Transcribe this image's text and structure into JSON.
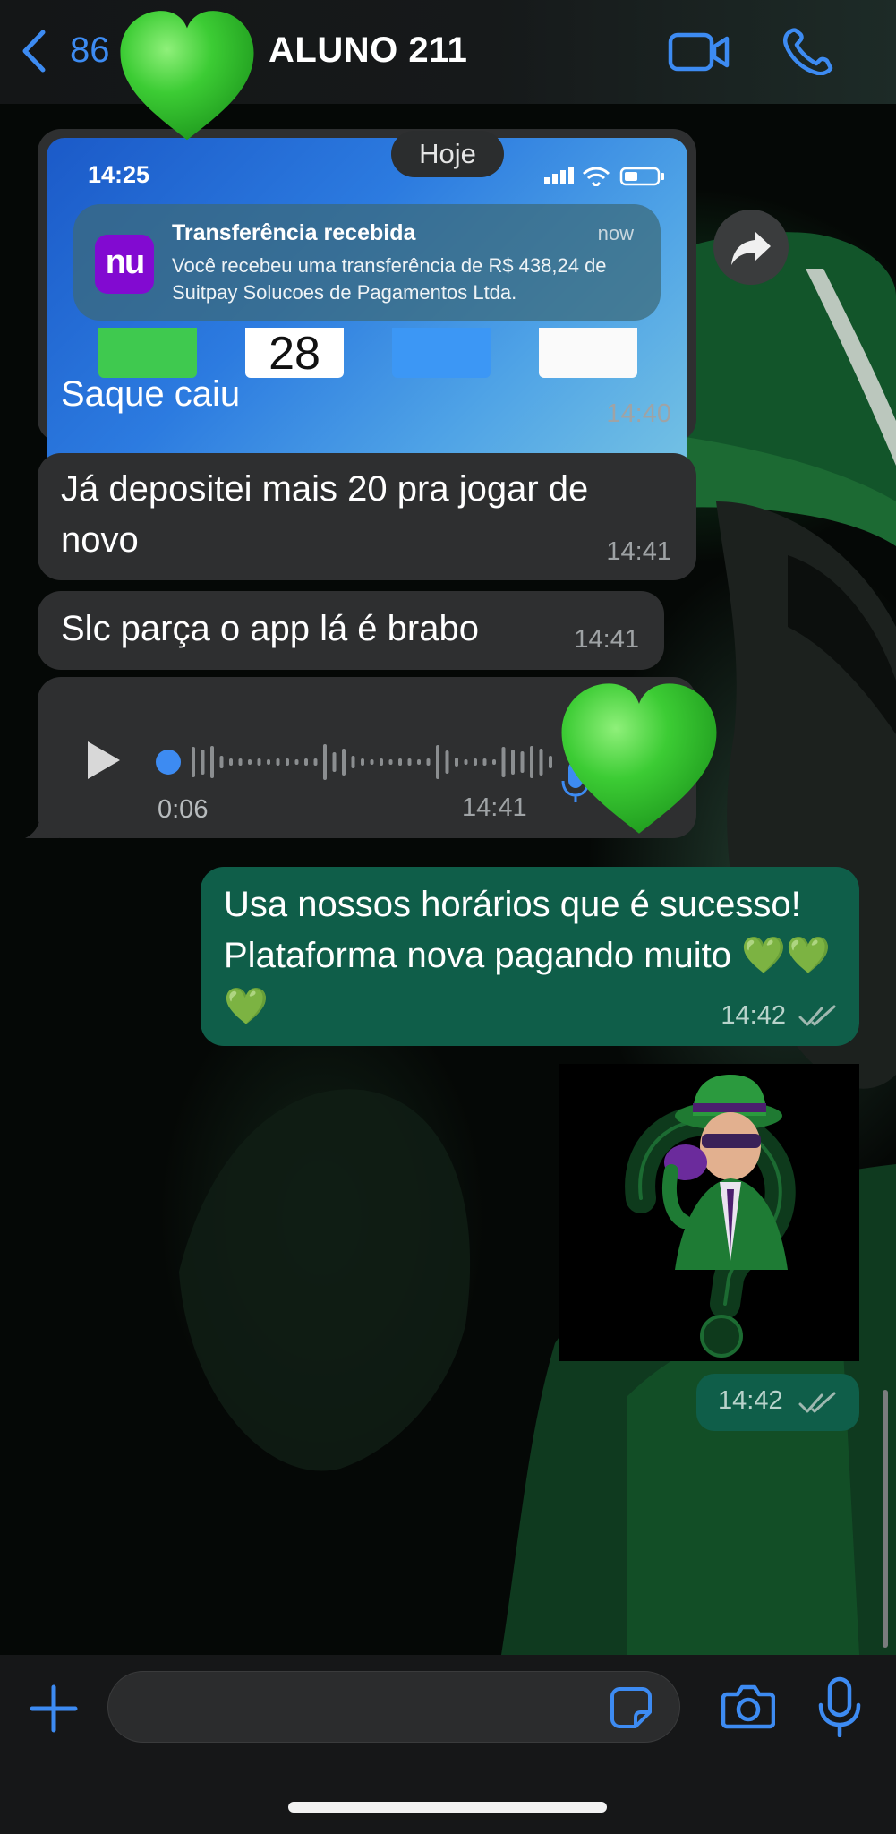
{
  "header": {
    "back_count": "86",
    "title": "ALUNO 211"
  },
  "date_separator": "Hoje",
  "messages": [
    {
      "type": "image",
      "direction": "incoming",
      "screenshot": {
        "clock": "14:25",
        "notification": {
          "app_logo": "nu",
          "title": "Transferência recebida",
          "when": "now",
          "body": "Você recebeu uma transferência de R$ 438,24 de Suitpay Solucoes de Pagamentos Ltda."
        },
        "calendar_day": "28"
      },
      "caption": "Saque caiu",
      "time": "14:40"
    },
    {
      "type": "text",
      "direction": "incoming",
      "text": "Já depositei mais 20 pra jogar de novo",
      "time": "14:41"
    },
    {
      "type": "text",
      "direction": "incoming",
      "text": "Slc parça o app lá é brabo",
      "time": "14:41"
    },
    {
      "type": "voice",
      "direction": "incoming",
      "duration": "0:06",
      "time": "14:41"
    },
    {
      "type": "text",
      "direction": "outgoing",
      "text": "Usa nossos horários que é sucesso! Plataforma nova pagando muito 💚💚💚",
      "time": "14:42",
      "status": "read"
    },
    {
      "type": "sticker",
      "direction": "outgoing",
      "time": "14:42",
      "status": "read"
    }
  ],
  "composer": {
    "placeholder": ""
  },
  "colors": {
    "accent": "#3d8bf2",
    "incoming_bubble": "#2e2f30",
    "outgoing_bubble": "#0f5e49",
    "heart": "#39c535"
  }
}
